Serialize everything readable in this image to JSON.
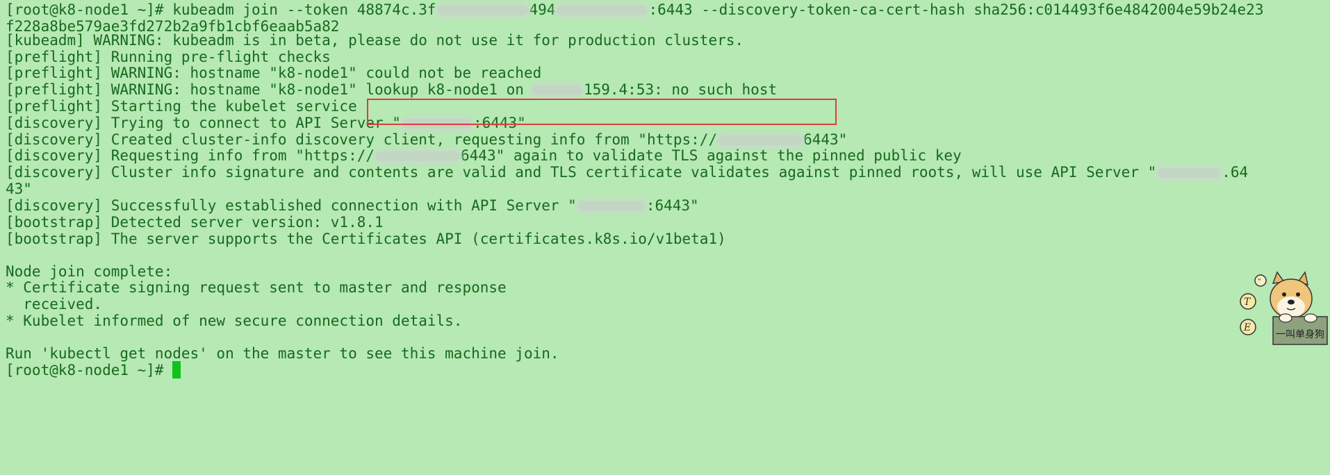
{
  "terminal": {
    "colors": {
      "background": "#b6e9b4",
      "text": "#17691f",
      "highlight_box": "#e03c3c",
      "cursor": "#10c21a"
    },
    "command_prefix": "[root@k8-node1 ~]# kubeadm join --token 48874c.3f",
    "command_mid": "494",
    "command_port": ":6443 --discovery-token-ca-cert-hash sha256:c014493f6e4842004e59b24e23",
    "command_cont": "f228a8be579ae3fd272b2a9fb1cbf6eaab5a82",
    "line_warn_beta": "[kubeadm] WARNING: kubeadm is in beta, please do not use it for production clusters.",
    "line_preflight_run": "[preflight] Running pre-flight checks",
    "line_preflight_warn1": "[preflight] WARNING: hostname \"k8-node1\" could not be reached",
    "line_preflight_warn2_prefix": "[preflight] WARNING: hostname \"k8-node1\" ",
    "line_preflight_warn2_lookup": "lookup k8-node1 on",
    "line_preflight_warn2_suffix": "159.4:53: no such host",
    "line_preflight_kubelet": "[preflight] Starting the kubelet service",
    "line_disc_try_prefix": "[discovery] Trying to connect to API Server \"",
    "line_disc_try_suffix": ":6443\"",
    "line_disc_created_prefix": "[discovery] Created cluster-info discovery client, requesting info from \"https://",
    "line_disc_created_suffix": "6443\"",
    "line_disc_req_prefix": "[discovery] Requesting info from \"https://",
    "line_disc_req_suffix": "6443\" again to validate TLS against the pinned public key",
    "line_disc_sig_prefix": "[discovery] Cluster info signature and contents are valid and TLS certificate validates against pinned roots, will use API Server \"",
    "line_disc_sig_suffix": ".64",
    "line_disc_sig_cont": "43\"",
    "line_disc_success_prefix": "[discovery] Successfully established connection with API Server \"",
    "line_disc_success_suffix": ":6443\"",
    "line_boot_version": "[bootstrap] Detected server version: v1.8.1",
    "line_boot_certs": "[bootstrap] The server supports the Certificates API (certificates.k8s.io/v1beta1)",
    "line_node_join": "Node join complete:",
    "line_csr": "* Certificate signing request sent to master and response",
    "line_csr_cont": "  received.",
    "line_kubelet_informed": "* Kubelet informed of new secure connection details.",
    "line_run_kubectl": "Run 'kubectl get nodes' on the master to see this machine join.",
    "prompt": "[root@k8-node1 ~]# "
  },
  "watermark": {
    "icon": "doge-sticker-icon",
    "sign_text": "一叫单身狗",
    "badges": [
      "T",
      "E"
    ]
  }
}
